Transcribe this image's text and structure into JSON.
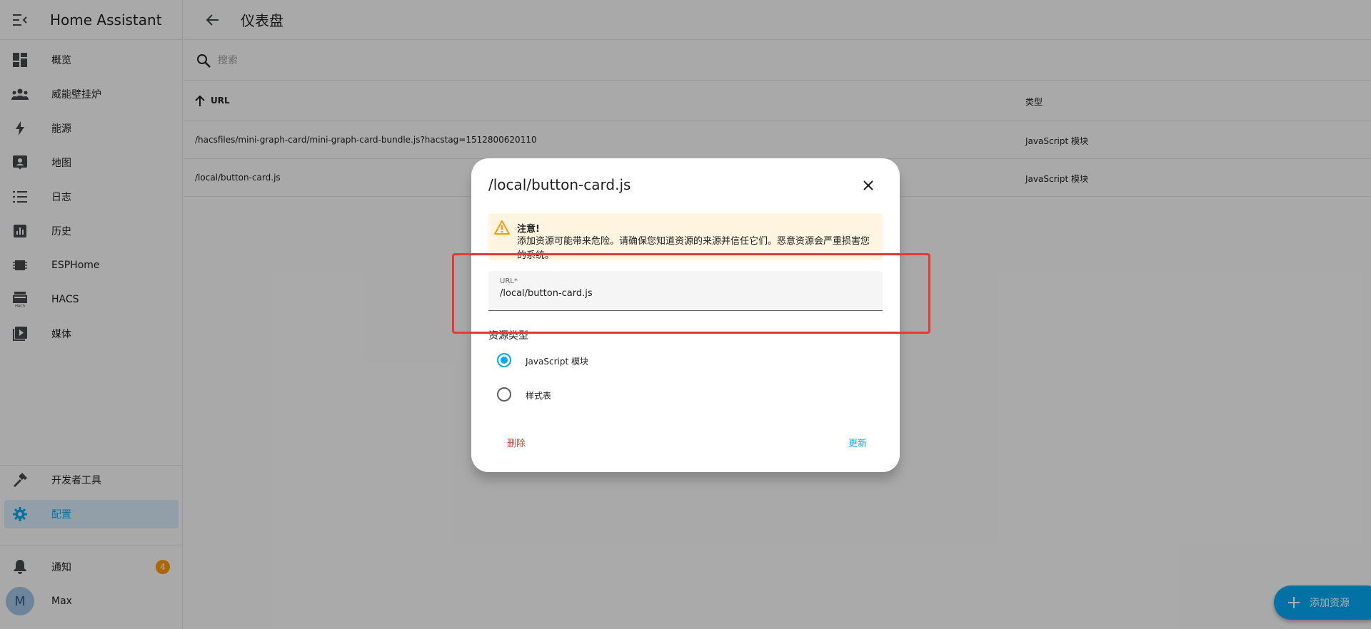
{
  "app": {
    "title": "Home Assistant"
  },
  "sidebar": {
    "items": [
      {
        "label": "概览",
        "icon": "dashboard-icon"
      },
      {
        "label": "威能壁挂炉",
        "icon": "people-icon"
      },
      {
        "label": "能源",
        "icon": "lightning-icon"
      },
      {
        "label": "地图",
        "icon": "map-pin-icon"
      },
      {
        "label": "日志",
        "icon": "list-icon"
      },
      {
        "label": "历史",
        "icon": "chart-icon"
      },
      {
        "label": "ESPHome",
        "icon": "chip-icon"
      },
      {
        "label": "HACS",
        "icon": "hacs-icon"
      },
      {
        "label": "媒体",
        "icon": "media-icon"
      }
    ],
    "dev_tools": {
      "label": "开发者工具"
    },
    "config": {
      "label": "配置"
    },
    "notifications": {
      "label": "通知",
      "count": "4"
    },
    "user": {
      "initial": "M",
      "name": "Max"
    }
  },
  "header": {
    "title": "仪表盘"
  },
  "search": {
    "placeholder": "搜索"
  },
  "table": {
    "columns": {
      "url": "URL",
      "type": "类型"
    },
    "rows": [
      {
        "url": "/hacsfiles/mini-graph-card/mini-graph-card-bundle.js?hacstag=1512800620110",
        "type": "JavaScript 模块"
      },
      {
        "url": "/local/button-card.js",
        "type": "JavaScript 模块"
      }
    ]
  },
  "fab": {
    "label": "添加资源"
  },
  "dialog": {
    "title": "/local/button-card.js",
    "alert": {
      "title": "注意!",
      "body": "添加资源可能带来危险。请确保您知道资源的来源并信任它们。恶意资源会严重损害您的系统。"
    },
    "url_field": {
      "label": "URL*",
      "value": "/local/button-card.js"
    },
    "resource_type": {
      "label": "资源类型",
      "options": [
        {
          "label": "JavaScript 模块",
          "checked": true
        },
        {
          "label": "样式表",
          "checked": false
        }
      ]
    },
    "delete_label": "删除",
    "update_label": "更新"
  },
  "colors": {
    "accent": "#03a9f4",
    "danger": "#db4437",
    "warning": "#ff9800",
    "highlight": "#e53935"
  }
}
